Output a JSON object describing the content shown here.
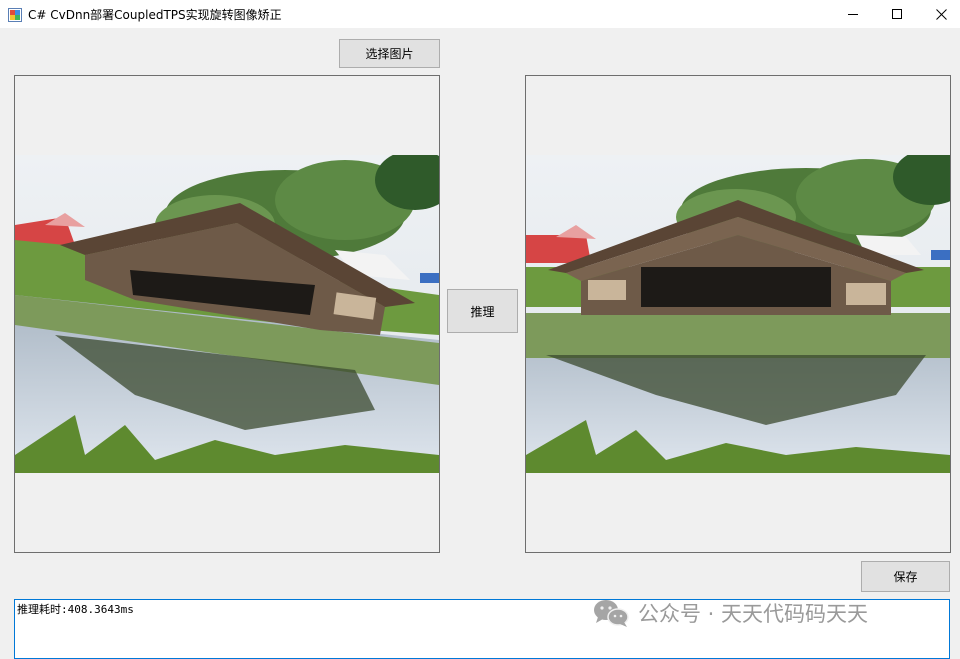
{
  "window": {
    "title": "C# CvDnn部署CoupledTPS实现旋转图像矫正",
    "app_icon": "winforms-app-icon",
    "controls": [
      "minimize-icon",
      "maximize-icon",
      "close-icon"
    ]
  },
  "buttons": {
    "select_image": "选择图片",
    "inference": "推理",
    "save": "保存"
  },
  "panels": {
    "input_image": "rotated-boathouse-photo",
    "output_image": "rectified-boathouse-photo"
  },
  "log": {
    "text": "推理耗时:408.3643ms"
  },
  "watermark": {
    "icon": "wechat-icon",
    "text": "公众号 · 天天代码码天天"
  },
  "colors": {
    "window_bg": "#f0f0f0",
    "button_bg": "#e1e1e1",
    "focus_border": "#0078d7"
  }
}
